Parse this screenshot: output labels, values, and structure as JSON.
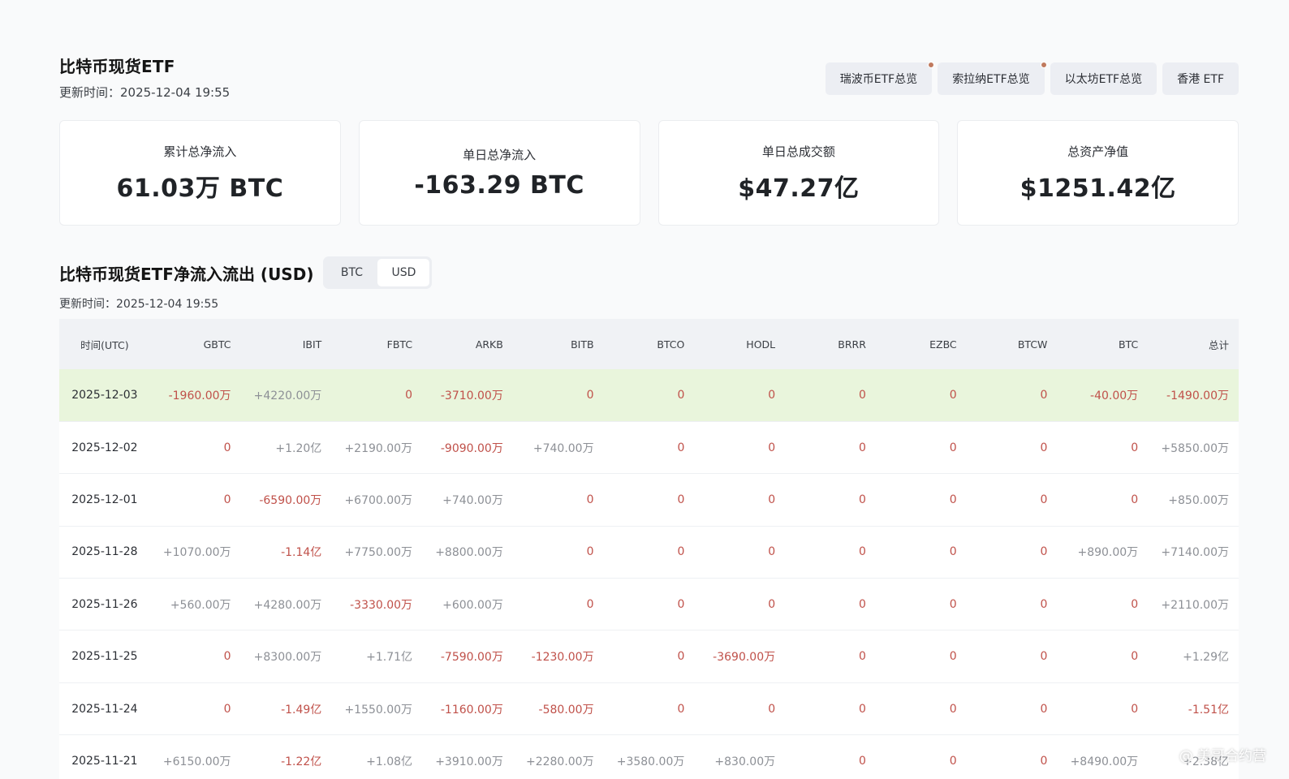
{
  "header": {
    "title": "比特币现货ETF",
    "updated": "更新时间：2025-12-04 19:55",
    "nav": [
      {
        "label": "瑞波币ETF总览",
        "dot": true
      },
      {
        "label": "索拉纳ETF总览",
        "dot": true
      },
      {
        "label": "以太坊ETF总览",
        "dot": false
      },
      {
        "label": "香港 ETF",
        "dot": false
      }
    ]
  },
  "stats": [
    {
      "label": "累计总净流入",
      "value": "61.03万 BTC"
    },
    {
      "label": "单日总净流入",
      "value": "-163.29 BTC"
    },
    {
      "label": "单日总成交额",
      "value": "$47.27亿"
    },
    {
      "label": "总资产净值",
      "value": "$1251.42亿"
    }
  ],
  "flow": {
    "title": "比特币现货ETF净流入流出 (USD)",
    "toggle": [
      "BTC",
      "USD"
    ],
    "toggle_active": "USD",
    "updated": "更新时间：2025-12-04 19:55",
    "columns": [
      "时间(UTC)",
      "GBTC",
      "IBIT",
      "FBTC",
      "ARKB",
      "BITB",
      "BTCO",
      "HODL",
      "BRRR",
      "EZBC",
      "BTCW",
      "BTC",
      "总计"
    ],
    "rows": [
      {
        "highlight": true,
        "cells": [
          "2025-12-03",
          "-1960.00万",
          "+4220.00万",
          "0",
          "-3710.00万",
          "0",
          "0",
          "0",
          "0",
          "0",
          "0",
          "-40.00万",
          "-1490.00万"
        ]
      },
      {
        "highlight": false,
        "cells": [
          "2025-12-02",
          "0",
          "+1.20亿",
          "+2190.00万",
          "-9090.00万",
          "+740.00万",
          "0",
          "0",
          "0",
          "0",
          "0",
          "0",
          "+5850.00万"
        ]
      },
      {
        "highlight": false,
        "cells": [
          "2025-12-01",
          "0",
          "-6590.00万",
          "+6700.00万",
          "+740.00万",
          "0",
          "0",
          "0",
          "0",
          "0",
          "0",
          "0",
          "+850.00万"
        ]
      },
      {
        "highlight": false,
        "cells": [
          "2025-11-28",
          "+1070.00万",
          "-1.14亿",
          "+7750.00万",
          "+8800.00万",
          "0",
          "0",
          "0",
          "0",
          "0",
          "0",
          "+890.00万",
          "+7140.00万"
        ]
      },
      {
        "highlight": false,
        "cells": [
          "2025-11-26",
          "+560.00万",
          "+4280.00万",
          "-3330.00万",
          "+600.00万",
          "0",
          "0",
          "0",
          "0",
          "0",
          "0",
          "0",
          "+2110.00万"
        ]
      },
      {
        "highlight": false,
        "cells": [
          "2025-11-25",
          "0",
          "+8300.00万",
          "+1.71亿",
          "-7590.00万",
          "-1230.00万",
          "0",
          "-3690.00万",
          "0",
          "0",
          "0",
          "0",
          "+1.29亿"
        ]
      },
      {
        "highlight": false,
        "cells": [
          "2025-11-24",
          "0",
          "-1.49亿",
          "+1550.00万",
          "-1160.00万",
          "-580.00万",
          "0",
          "0",
          "0",
          "0",
          "0",
          "0",
          "-1.51亿"
        ]
      },
      {
        "highlight": false,
        "cells": [
          "2025-11-21",
          "+6150.00万",
          "-1.22亿",
          "+1.08亿",
          "+3910.00万",
          "+2280.00万",
          "+3580.00万",
          "+830.00万",
          "0",
          "0",
          "0",
          "+8490.00万",
          "+2.38亿"
        ]
      }
    ]
  },
  "watermark": "@ 美哥合约营",
  "colors": {
    "negative": "#c0514a",
    "positive": "#8d9096",
    "highlight_row": "#e9f5dc"
  }
}
